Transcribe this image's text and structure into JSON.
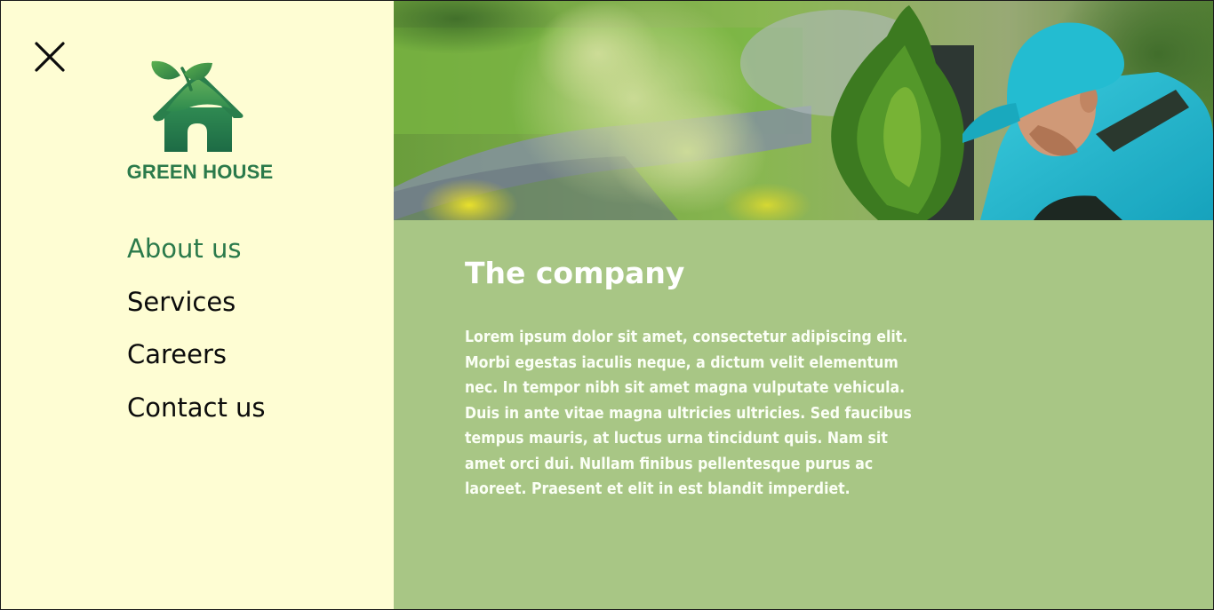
{
  "brand": {
    "name": "GREEN HOUSE",
    "color": "#2b7a4b"
  },
  "close_button": {
    "icon": "close-icon"
  },
  "nav": {
    "items": [
      {
        "label": "About us",
        "active": true
      },
      {
        "label": "Services",
        "active": false
      },
      {
        "label": "Careers",
        "active": false
      },
      {
        "label": "Contact us",
        "active": false
      }
    ]
  },
  "hero": {
    "image": "gardener-planting-shrub-photo"
  },
  "content": {
    "title": "The company",
    "body": "Lorem ipsum dolor sit amet, consectetur adipiscing elit. Morbi egestas iaculis neque, a dictum velit elementum nec. In tempor nibh sit amet magna vulputate vehicula. Duis in ante vitae magna ultricies ultricies. Sed faucibus tempus mauris, at luctus urna tincidunt quis. Nam sit amet orci dui. Nullam finibus pellentesque purus ac laoreet. Praesent et elit in est blandit imperdiet."
  },
  "colors": {
    "sidebar_bg": "#fefdd3",
    "content_bg": "#a8c685",
    "accent": "#2b7a4b",
    "text_dark": "#0c0c0c",
    "text_light": "#ffffff"
  }
}
